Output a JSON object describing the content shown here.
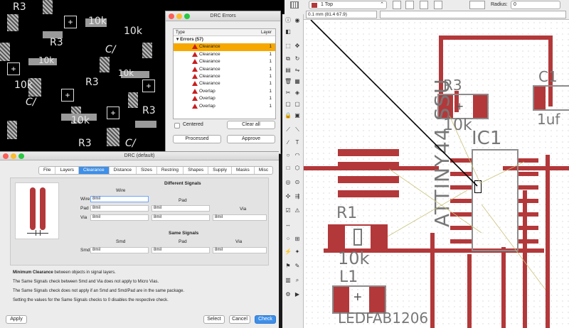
{
  "drc_errors": {
    "title": "DRC Errors",
    "col_type": "Type",
    "col_layer": "Layer",
    "group_label": "Errors (57)",
    "rows": [
      {
        "label": "Clearance",
        "layer": "1"
      },
      {
        "label": "Clearance",
        "layer": "1"
      },
      {
        "label": "Clearance",
        "layer": "1"
      },
      {
        "label": "Clearance",
        "layer": "1"
      },
      {
        "label": "Clearance",
        "layer": "1"
      },
      {
        "label": "Clearance",
        "layer": "1"
      },
      {
        "label": "Overlap",
        "layer": "1"
      },
      {
        "label": "Overlap",
        "layer": "1"
      },
      {
        "label": "Overlap",
        "layer": "1"
      }
    ],
    "centered_label": "Centered",
    "clear_all": "Clear all",
    "processed": "Processed",
    "approve": "Approve"
  },
  "drc": {
    "title": "DRC (default)",
    "tabs": [
      "File",
      "Layers",
      "Clearance",
      "Distance",
      "Sizes",
      "Restring",
      "Shapes",
      "Supply",
      "Masks",
      "Misc"
    ],
    "active_tab": "Clearance",
    "different_signals": "Different Signals",
    "same_signals": "Same Signals",
    "col_wire": "Wire",
    "col_pad": "Pad",
    "col_via": "Via",
    "col_smd": "Smd",
    "row_wire": "Wire",
    "row_pad": "Pad",
    "row_via": "Via",
    "row_smd": "Smd",
    "value": "8mil",
    "desc1_bold": "Minimum Clearance",
    "desc1_rest": " between objects in signal layers.",
    "desc2": "The Same Signals check between Smd and Via does not apply to Micro Vias.",
    "desc3": "The Same Signals check does not apply if an Smd and Smd/Pad are in the same package.",
    "desc4": "Setting the values for the Same Signals checks to 0 disables the respective check.",
    "apply": "Apply",
    "select": "Select",
    "cancel": "Cancel",
    "check": "Check"
  },
  "toolbar": {
    "layer": "1 Top",
    "radius_label": "Radius:",
    "radius_value": "0",
    "coord": "0.1 mm (81.4 67.9)"
  },
  "pcb": {
    "r3": "R3",
    "r3_val": "10k",
    "c1": "C1",
    "c1_val": "1uf",
    "ic1": "IC1",
    "ic1_name": "ATTINY44 SSU",
    "r1": "R1",
    "r1_val": "10k",
    "l1": "L1",
    "l1_val": "LEDFAB1206"
  },
  "schematic_labels": {
    "r3": "R3",
    "k10": "10k",
    "ca": "C/"
  }
}
